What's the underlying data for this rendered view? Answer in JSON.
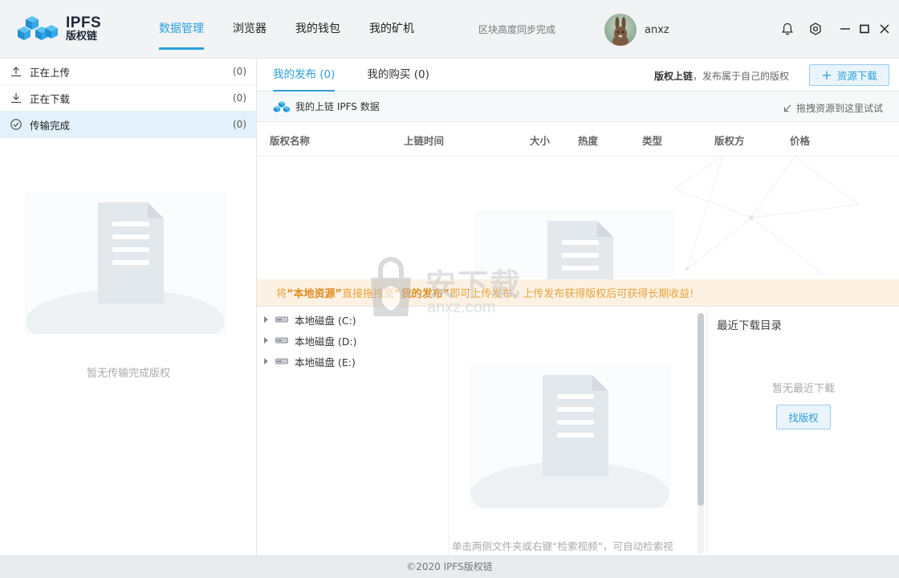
{
  "app": {
    "title": "IPFS",
    "subtitle": "版权链"
  },
  "nav": {
    "items": [
      {
        "label": "数据管理",
        "active": true
      },
      {
        "label": "浏览器",
        "active": false
      },
      {
        "label": "我的钱包",
        "active": false
      },
      {
        "label": "我的矿机",
        "active": false
      }
    ]
  },
  "header": {
    "sync_status": "区块高度同步完成",
    "username": "anxz",
    "icons": [
      "bell-icon",
      "settings-icon",
      "minimize-icon",
      "maximize-icon",
      "close-icon"
    ]
  },
  "transfers": {
    "items": [
      {
        "label": "正在上传",
        "count": "(0)",
        "icon": "upload-icon"
      },
      {
        "label": "正在下载",
        "count": "(0)",
        "icon": "download-icon"
      },
      {
        "label": "传输完成",
        "count": "(0)",
        "icon": "check-circle-icon",
        "active": true
      }
    ],
    "empty_text": "暂无传输完成版权"
  },
  "tabs": {
    "items": [
      {
        "label": "我的发布 (0)",
        "active": true
      },
      {
        "label": "我的购买 (0)",
        "active": false
      }
    ],
    "upload_hint_bold": "版权上链",
    "upload_hint_rest": "，发布属于自己的版权",
    "download_button": "资源下载"
  },
  "subbar": {
    "label": "我的上链 IPFS 数据",
    "drag_hint": "拖拽资源到这里试试"
  },
  "table": {
    "columns": [
      "版权名称",
      "上链时间",
      "大小",
      "热度",
      "类型",
      "版权方",
      "价格"
    ]
  },
  "banner": {
    "part1": "将 ",
    "bold1": "“本地资源”",
    "part2": " 直接拖拽至 ",
    "bold2": "“我的发布”",
    "part3": " 即可上传发布，上传发布获得版权后可获得长期收益!"
  },
  "disks": {
    "items": [
      "本地磁盘 (C:)",
      "本地磁盘 (D:)",
      "本地磁盘 (E:)"
    ]
  },
  "mid": {
    "hint": "单击两侧文件夹或右键“检索视频”，可自动检索视"
  },
  "recent": {
    "title": "最近下载目录",
    "empty_text": "暂无最近下载",
    "find_button": "找版权"
  },
  "footer": {
    "copyright": "©2020 IPFS版权链"
  },
  "watermark": {
    "text": "安下载",
    "sub": "anxz.com"
  },
  "colors": {
    "accent": "#2b9fdc",
    "banner_bg": "#fcf1e2",
    "banner_text": "#e8a33d",
    "header_bg": "#f2f3f5"
  }
}
